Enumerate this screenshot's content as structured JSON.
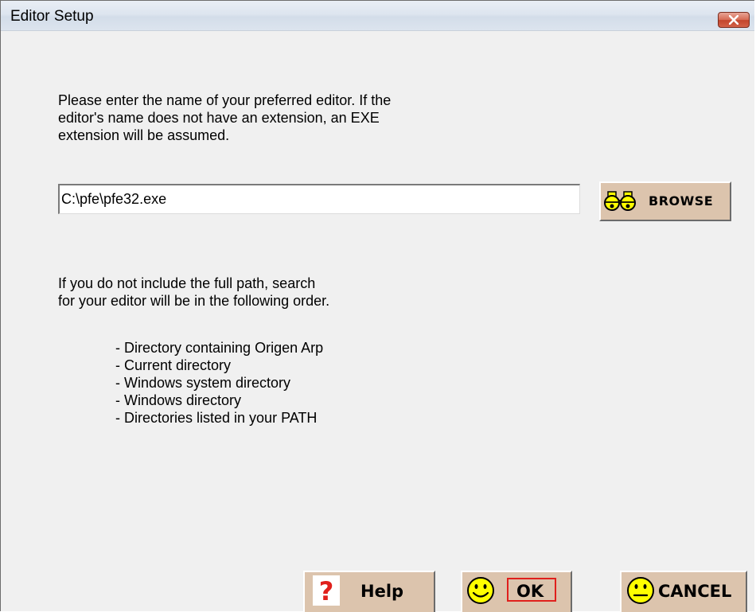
{
  "window": {
    "title": "Editor Setup"
  },
  "intro_lines": [
    "Please enter the name of your preferred editor.  If the",
    "editor's name does not have an extension, an EXE",
    "extension will be assumed."
  ],
  "editor_path": {
    "value": "C:\\pfe\\pfe32.exe"
  },
  "browse": {
    "label": "BROWSE",
    "icon": "binoculars-icon"
  },
  "search_note_lines": [
    "If you do not include the full path, search",
    "for your editor will be in the following order."
  ],
  "search_order": [
    "- Directory containing  Origen Arp",
    "- Current directory",
    "- Windows system directory",
    "- Windows directory",
    "- Directories listed in your PATH"
  ],
  "buttons": {
    "help": {
      "label": "Help",
      "icon": "question-mark-icon"
    },
    "ok": {
      "label": "OK",
      "icon": "smiley-icon"
    },
    "cancel": {
      "label": "CANCEL",
      "icon": "neutral-face-icon"
    }
  },
  "colors": {
    "button_face": "#dcc4ad",
    "ok_focus_border": "#e0201c",
    "smiley_yellow": "#ffff00",
    "help_red": "#e0201c"
  }
}
